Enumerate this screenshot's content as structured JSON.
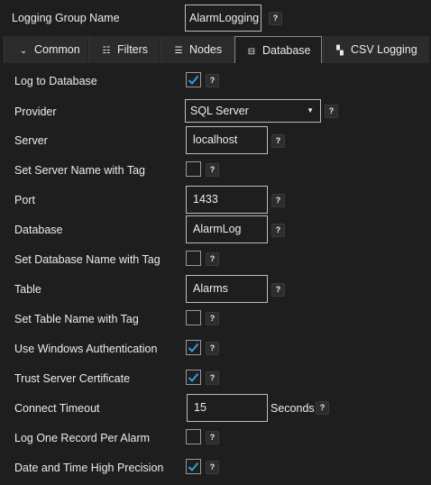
{
  "header": {
    "group_name_label": "Logging Group Name",
    "group_name_value": "AlarmLogging",
    "help": "?"
  },
  "tabs": [
    {
      "label": "Common",
      "icon": "chevron-double-down-icon",
      "glyph": "⌄"
    },
    {
      "label": "Filters",
      "icon": "filter-list-icon",
      "glyph": "☷"
    },
    {
      "label": "Nodes",
      "icon": "nodes-icon",
      "glyph": "☰"
    },
    {
      "label": "Database",
      "icon": "database-icon",
      "glyph": "⊟",
      "active": true
    },
    {
      "label": "CSV Logging",
      "icon": "csv-file-icon",
      "glyph": "▚"
    }
  ],
  "form": {
    "log_to_database": {
      "label": "Log to Database",
      "checked": true
    },
    "provider": {
      "label": "Provider",
      "value": "SQL Server"
    },
    "server": {
      "label": "Server",
      "value": "localhost"
    },
    "server_from_tag": {
      "label": "Set Server Name with Tag",
      "checked": false
    },
    "port": {
      "label": "Port",
      "value": "1433"
    },
    "database": {
      "label": "Database",
      "value": "AlarmLog"
    },
    "database_from_tag": {
      "label": "Set Database Name with Tag",
      "checked": false
    },
    "table": {
      "label": "Table",
      "value": "Alarms"
    },
    "table_from_tag": {
      "label": "Set Table Name with Tag",
      "checked": false
    },
    "windows_auth": {
      "label": "Use Windows Authentication",
      "checked": true
    },
    "trust_cert": {
      "label": "Trust Server Certificate",
      "checked": true
    },
    "connect_timeout": {
      "label": "Connect Timeout",
      "value": "15",
      "unit": "Seconds"
    },
    "one_record": {
      "label": "Log One Record Per Alarm",
      "checked": false
    },
    "high_precision": {
      "label": "Date and Time High Precision",
      "checked": true
    }
  },
  "colors": {
    "check": "#3a9ad9",
    "background": "#1e1e1e"
  }
}
